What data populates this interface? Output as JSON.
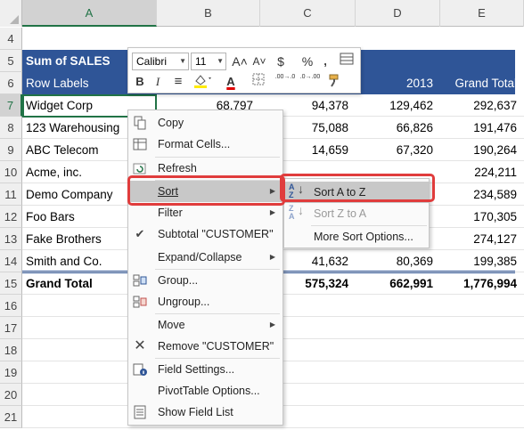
{
  "columns": [
    "A",
    "B",
    "C",
    "D",
    "E"
  ],
  "rows": [
    {
      "num": "4",
      "a": "",
      "b": "",
      "c": "",
      "d": "",
      "e": ""
    },
    {
      "num": "5",
      "a": "Sum of SALES",
      "b": "",
      "c": "",
      "d": "",
      "e": ""
    },
    {
      "num": "6",
      "a": "Row Labels",
      "b": "",
      "c": "",
      "d": "2013",
      "e": "Grand Total"
    },
    {
      "num": "7",
      "a": "Widget Corp",
      "b": "68,797",
      "c": "94,378",
      "d": "129,462",
      "e": "292,637"
    },
    {
      "num": "8",
      "a": "123 Warehousing",
      "b": "",
      "c": "75,088",
      "d": "66,826",
      "e": "191,476"
    },
    {
      "num": "9",
      "a": "ABC Telecom",
      "b": "",
      "c": "14,659",
      "d": "67,320",
      "e": "190,264"
    },
    {
      "num": "10",
      "a": "Acme, inc.",
      "b": "",
      "c": "",
      "d": "",
      "e": "224,211"
    },
    {
      "num": "11",
      "a": "Demo Company",
      "b": "",
      "c": "",
      "d": "",
      "e": "234,589"
    },
    {
      "num": "12",
      "a": "Foo Bars",
      "b": "",
      "c": "",
      "d": "",
      "e": "170,305"
    },
    {
      "num": "13",
      "a": "Fake Brothers",
      "b": "",
      "c": "",
      "d": "",
      "e": "274,127"
    },
    {
      "num": "14",
      "a": "Smith and Co.",
      "b": "",
      "c": "41,632",
      "d": "80,369",
      "e": "199,385"
    },
    {
      "num": "15",
      "a": "Grand Total",
      "b": "",
      "c": "575,324",
      "d": "662,991",
      "e": "1,776,994"
    },
    {
      "num": "16"
    },
    {
      "num": "17"
    },
    {
      "num": "18"
    },
    {
      "num": "19"
    },
    {
      "num": "20"
    },
    {
      "num": "21"
    }
  ],
  "mini_toolbar": {
    "font": "Calibri",
    "size": "11",
    "grow_font": "A˄",
    "shrink_font": "A˅",
    "currency": "$",
    "percent": "%",
    "comma": ",",
    "bold": "B",
    "italic": "I",
    "align": "≡",
    "font_color": "A",
    "increase_decimal": ".00→.0",
    "decrease_decimal": ".0→.00"
  },
  "context_menu": {
    "copy": "Copy",
    "format_cells": "Format Cells...",
    "refresh": "Refresh",
    "sort": "Sort",
    "filter": "Filter",
    "subtotal": "Subtotal \"CUSTOMER\"",
    "expand_collapse": "Expand/Collapse",
    "group": "Group...",
    "ungroup": "Ungroup...",
    "move": "Move",
    "remove": "Remove \"CUSTOMER\"",
    "field_settings": "Field Settings...",
    "pivottable_options": "PivotTable Options...",
    "show_field_list": "Show Field List"
  },
  "sort_submenu": {
    "sort_a_to_z": "Sort A to Z",
    "sort_z_to_a": "Sort Z to A",
    "more_sort_options": "More Sort Options..."
  },
  "colors": {
    "header_fill": "#2f5597",
    "highlight_outline": "#e03c3c",
    "excel_green": "#217346"
  }
}
